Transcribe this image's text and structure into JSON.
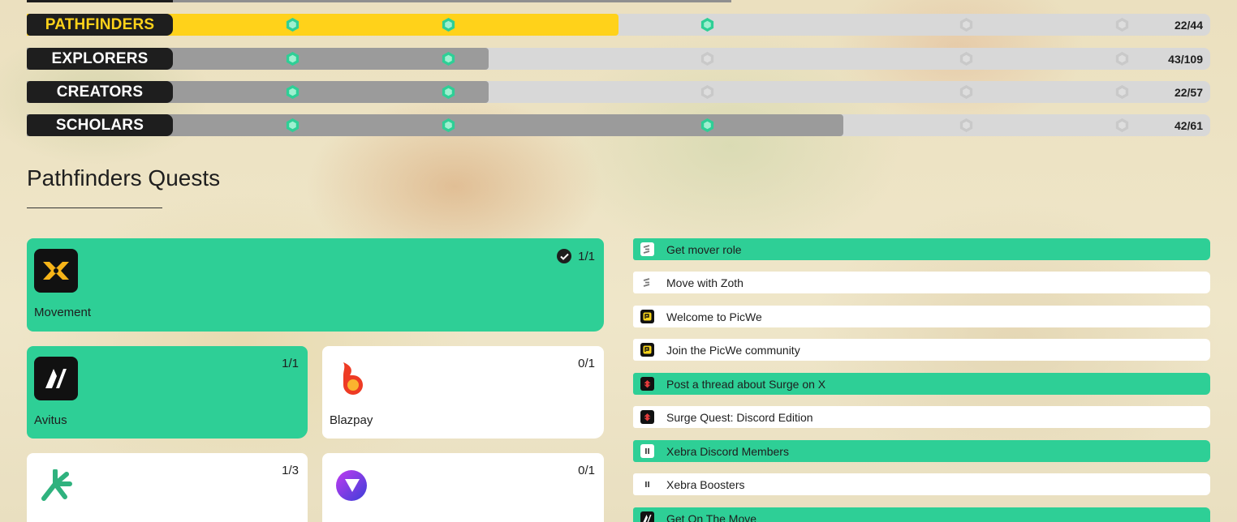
{
  "colors": {
    "accent_green": "#2ecf96",
    "tier_yellow": "#ffd21a",
    "tier_gray": "#9b9b9b",
    "track_light": "#d8d8d8",
    "dark": "#1e1e1e"
  },
  "tiers": [
    {
      "name": "PATHFINDERS",
      "count": "22/44",
      "progress": 0.5,
      "active": true
    },
    {
      "name": "EXPLORERS",
      "count": "43/109",
      "progress": 0.39,
      "active": false
    },
    {
      "name": "CREATORS",
      "count": "22/57",
      "progress": 0.39,
      "active": false
    },
    {
      "name": "SCHOLARS",
      "count": "42/61",
      "progress": 0.69,
      "active": false
    }
  ],
  "milestones_reached": [
    3,
    2,
    2,
    3
  ],
  "section": {
    "title": "Pathfinders Quests"
  },
  "cards": [
    {
      "name": "Movement",
      "progress": "1/1",
      "completed": true,
      "icon": "movement-logo"
    },
    {
      "name": "Avitus",
      "progress": "1/1",
      "completed": true,
      "icon": "avitus-logo"
    },
    {
      "name": "Blazpay",
      "progress": "0/1",
      "completed": false,
      "icon": "blazpay-logo"
    },
    {
      "name": "",
      "progress": "1/3",
      "completed": false,
      "icon": "green-star-logo"
    },
    {
      "name": "",
      "progress": "0/1",
      "completed": false,
      "icon": "purple-play-logo"
    }
  ],
  "quests": [
    {
      "label": "Get mover role",
      "completed": true,
      "icon": "zoth-icon"
    },
    {
      "label": "Move with Zoth",
      "completed": false,
      "icon": "zoth-icon"
    },
    {
      "label": "Welcome to PicWe",
      "completed": false,
      "icon": "picwe-icon"
    },
    {
      "label": "Join the PicWe community",
      "completed": false,
      "icon": "picwe-icon"
    },
    {
      "label": "Post a thread about Surge on X",
      "completed": true,
      "icon": "surge-icon"
    },
    {
      "label": "Surge Quest: Discord Edition",
      "completed": false,
      "icon": "surge-icon"
    },
    {
      "label": "Xebra Discord Members",
      "completed": true,
      "icon": "xebra-icon"
    },
    {
      "label": "Xebra Boosters",
      "completed": false,
      "icon": "xebra-icon"
    },
    {
      "label": "Get On The Move",
      "completed": true,
      "icon": "avitus-icon"
    }
  ]
}
